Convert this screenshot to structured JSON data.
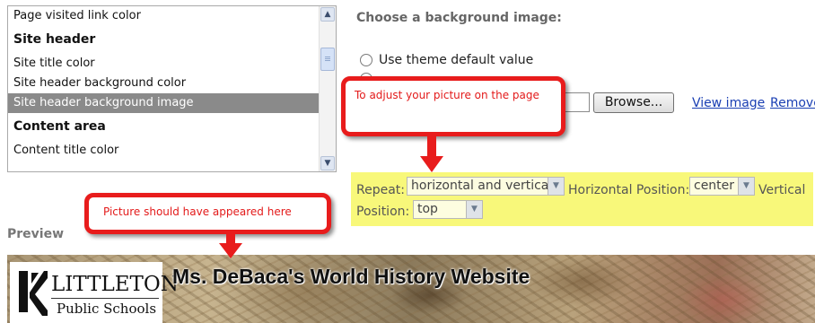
{
  "list": {
    "items": [
      {
        "label": "Page visited link color",
        "type": "item"
      },
      {
        "label": "Site header",
        "type": "header"
      },
      {
        "label": "Site title color",
        "type": "item"
      },
      {
        "label": "Site header background color",
        "type": "item"
      },
      {
        "label": "Site header background image",
        "type": "item",
        "selected": true
      },
      {
        "label": "Content area",
        "type": "header"
      },
      {
        "label": "Content title color",
        "type": "item"
      }
    ],
    "scroll_up_icon": "chevron-up-icon",
    "scroll_down_icon": "chevron-down-icon"
  },
  "background": {
    "heading": "Choose a background image:",
    "option_default": "Use theme default value",
    "browse_label": "Browse...",
    "view_image_label": "View image",
    "remove_label": "Remove"
  },
  "position": {
    "repeat_label": "Repeat:",
    "repeat_value": "horizontal and vertical",
    "horizontal_label": "Horizontal Position:",
    "horizontal_value": "center",
    "vertical_label_part1": "Vertical",
    "vertical_label_part2": "Position:",
    "vertical_value": "top",
    "highlight_color": "#f8f87a"
  },
  "callouts": {
    "adjust": "To adjust your picture on the page",
    "picture": "Picture should have appeared here",
    "color": "#e81c1c"
  },
  "preview": {
    "label": "Preview",
    "logo_title": "LITTLETON",
    "logo_sub": "Public Schools",
    "site_title": "Ms. DeBaca's World History Website"
  }
}
